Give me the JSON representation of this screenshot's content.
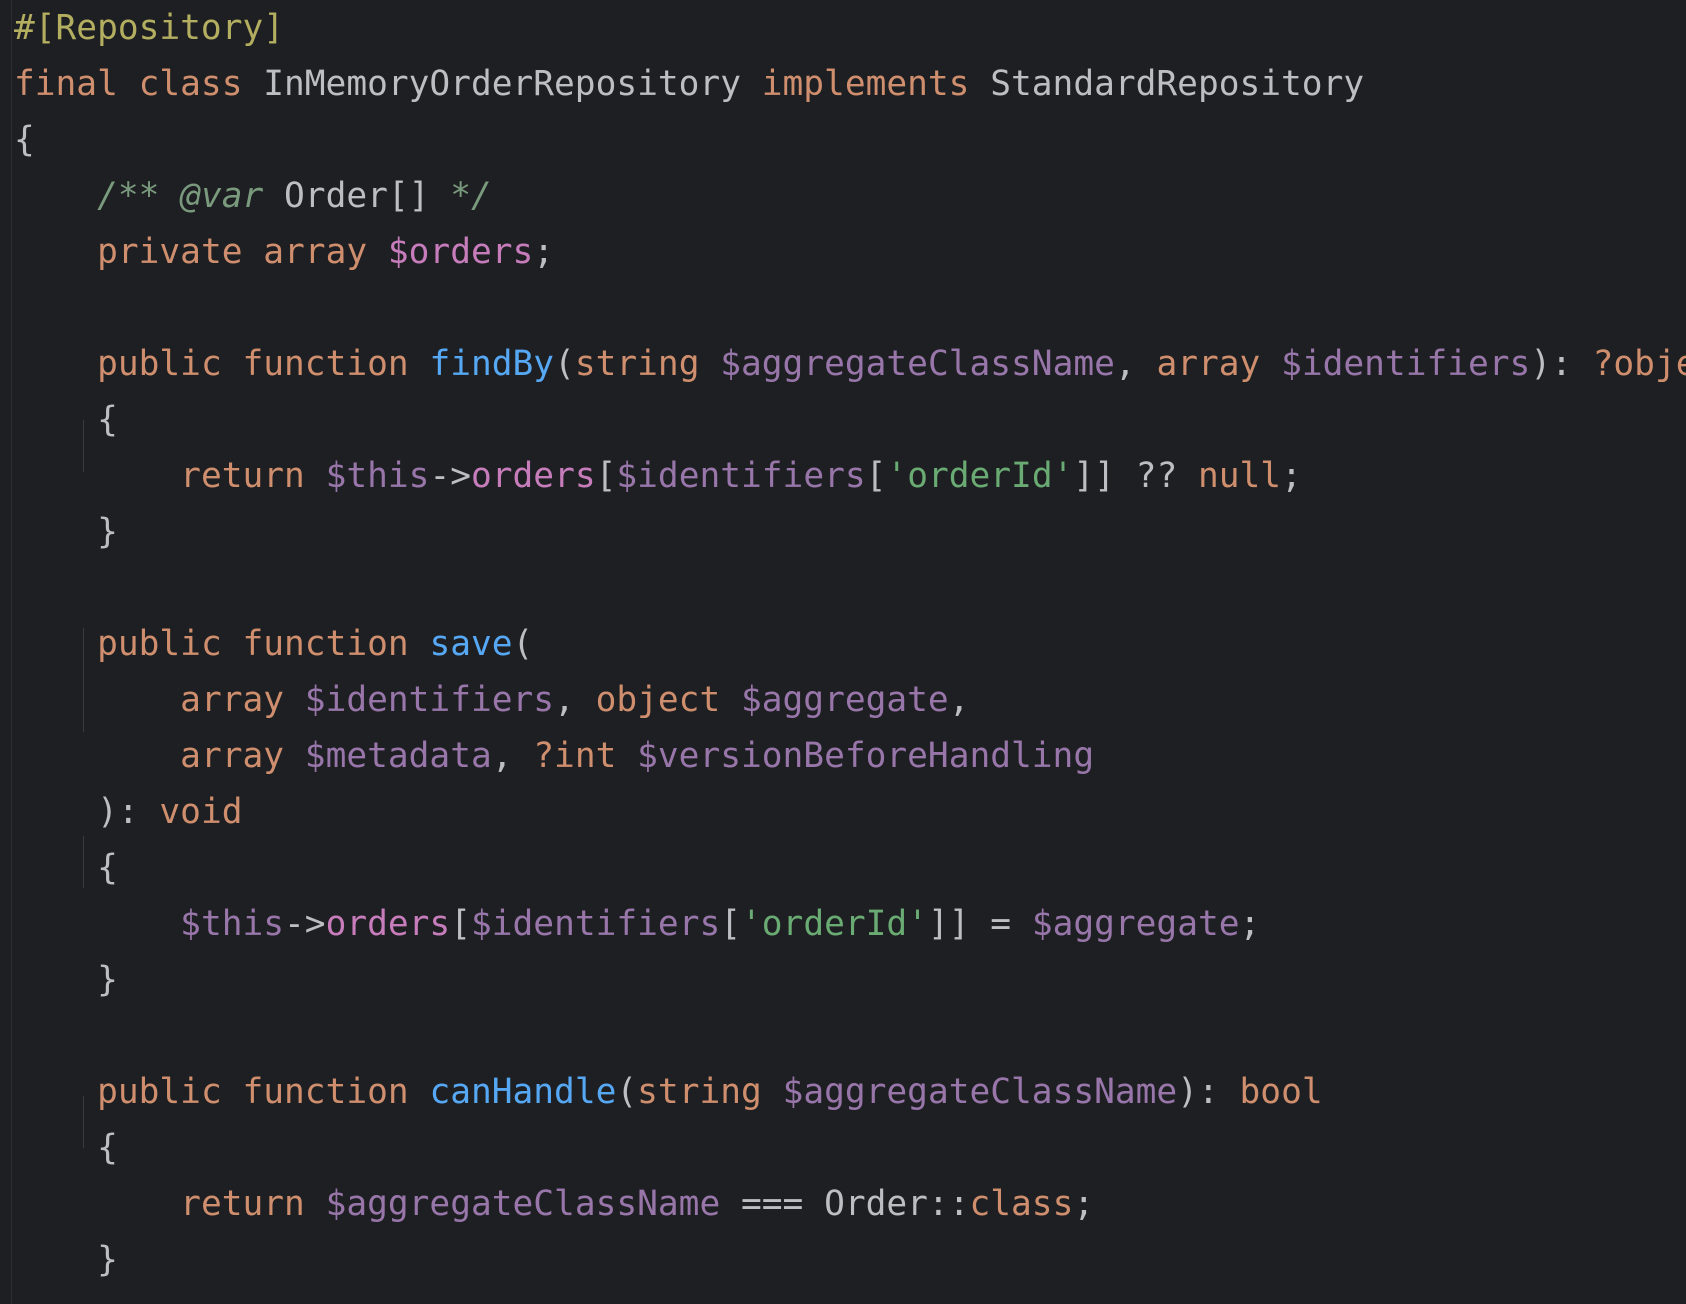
{
  "editor": {
    "language": "PHP",
    "lines": [
      [
        {
          "t": "#[Repository]",
          "c": "ann"
        }
      ],
      [
        {
          "t": "final class ",
          "c": "kw"
        },
        {
          "t": "InMemoryOrderRepository ",
          "c": "plain"
        },
        {
          "t": "implements ",
          "c": "kw"
        },
        {
          "t": "StandardRepository",
          "c": "plain"
        }
      ],
      [
        {
          "t": "{",
          "c": "plain"
        }
      ],
      [
        {
          "t": "    ",
          "c": "plain"
        },
        {
          "t": "/** @var ",
          "c": "cmt"
        },
        {
          "t": "Order[]",
          "c": "plain"
        },
        {
          "t": " */",
          "c": "cmt"
        }
      ],
      [
        {
          "t": "    ",
          "c": "plain"
        },
        {
          "t": "private array ",
          "c": "kw"
        },
        {
          "t": "$orders",
          "c": "var"
        },
        {
          "t": ";",
          "c": "plain"
        }
      ],
      [],
      [
        {
          "t": "    ",
          "c": "plain"
        },
        {
          "t": "public function ",
          "c": "kw"
        },
        {
          "t": "findBy",
          "c": "fn"
        },
        {
          "t": "(",
          "c": "plain"
        },
        {
          "t": "string ",
          "c": "kw"
        },
        {
          "t": "$aggregateClassName",
          "c": "prm"
        },
        {
          "t": ", ",
          "c": "plain"
        },
        {
          "t": "array ",
          "c": "kw"
        },
        {
          "t": "$identifiers",
          "c": "prm"
        },
        {
          "t": "): ",
          "c": "plain"
        },
        {
          "t": "?object",
          "c": "kw"
        }
      ],
      [
        {
          "t": "    {",
          "c": "plain"
        }
      ],
      [
        {
          "t": "        ",
          "c": "plain"
        },
        {
          "t": "return ",
          "c": "kw"
        },
        {
          "t": "$this",
          "c": "prm"
        },
        {
          "t": "->",
          "c": "plain"
        },
        {
          "t": "orders",
          "c": "var"
        },
        {
          "t": "[",
          "c": "plain"
        },
        {
          "t": "$identifiers",
          "c": "prm"
        },
        {
          "t": "[",
          "c": "plain"
        },
        {
          "t": "'orderId'",
          "c": "str"
        },
        {
          "t": "]] ?? ",
          "c": "plain"
        },
        {
          "t": "null",
          "c": "kw"
        },
        {
          "t": ";",
          "c": "plain"
        }
      ],
      [
        {
          "t": "    }",
          "c": "plain"
        }
      ],
      [],
      [
        {
          "t": "    ",
          "c": "plain"
        },
        {
          "t": "public function ",
          "c": "kw"
        },
        {
          "t": "save",
          "c": "fn"
        },
        {
          "t": "(",
          "c": "plain"
        }
      ],
      [
        {
          "t": "        ",
          "c": "plain"
        },
        {
          "t": "array ",
          "c": "kw"
        },
        {
          "t": "$identifiers",
          "c": "prm"
        },
        {
          "t": ", ",
          "c": "plain"
        },
        {
          "t": "object ",
          "c": "kw"
        },
        {
          "t": "$aggregate",
          "c": "prm"
        },
        {
          "t": ",",
          "c": "plain"
        }
      ],
      [
        {
          "t": "        ",
          "c": "plain"
        },
        {
          "t": "array ",
          "c": "kw"
        },
        {
          "t": "$metadata",
          "c": "prm"
        },
        {
          "t": ", ",
          "c": "plain"
        },
        {
          "t": "?int ",
          "c": "kw"
        },
        {
          "t": "$versionBeforeHandling",
          "c": "prm"
        }
      ],
      [
        {
          "t": "    ): ",
          "c": "plain"
        },
        {
          "t": "void",
          "c": "kw"
        }
      ],
      [
        {
          "t": "    {",
          "c": "plain"
        }
      ],
      [
        {
          "t": "        ",
          "c": "plain"
        },
        {
          "t": "$this",
          "c": "prm"
        },
        {
          "t": "->",
          "c": "plain"
        },
        {
          "t": "orders",
          "c": "var"
        },
        {
          "t": "[",
          "c": "plain"
        },
        {
          "t": "$identifiers",
          "c": "prm"
        },
        {
          "t": "[",
          "c": "plain"
        },
        {
          "t": "'orderId'",
          "c": "str"
        },
        {
          "t": "]] = ",
          "c": "plain"
        },
        {
          "t": "$aggregate",
          "c": "prm"
        },
        {
          "t": ";",
          "c": "plain"
        }
      ],
      [
        {
          "t": "    }",
          "c": "plain"
        }
      ],
      [],
      [
        {
          "t": "    ",
          "c": "plain"
        },
        {
          "t": "public function ",
          "c": "kw"
        },
        {
          "t": "canHandle",
          "c": "fn"
        },
        {
          "t": "(",
          "c": "plain"
        },
        {
          "t": "string ",
          "c": "kw"
        },
        {
          "t": "$aggregateClassName",
          "c": "prm"
        },
        {
          "t": "): ",
          "c": "plain"
        },
        {
          "t": "bool",
          "c": "kw"
        }
      ],
      [
        {
          "t": "    {",
          "c": "plain"
        }
      ],
      [
        {
          "t": "        ",
          "c": "plain"
        },
        {
          "t": "return ",
          "c": "kw"
        },
        {
          "t": "$aggregateClassName",
          "c": "prm"
        },
        {
          "t": " === Order::",
          "c": "plain"
        },
        {
          "t": "class",
          "c": "kw"
        },
        {
          "t": ";",
          "c": "plain"
        }
      ],
      [
        {
          "t": "    }",
          "c": "plain"
        }
      ]
    ]
  },
  "colors": {
    "background": "#1e1f22",
    "keyword": "#cf8e6d",
    "function": "#56a8f5",
    "variable": "#c77dbb",
    "parameter": "#9876aa",
    "string": "#6aab73",
    "comment": "#7a9a7e",
    "attribute": "#b3ae60",
    "text": "#bcbec4"
  }
}
